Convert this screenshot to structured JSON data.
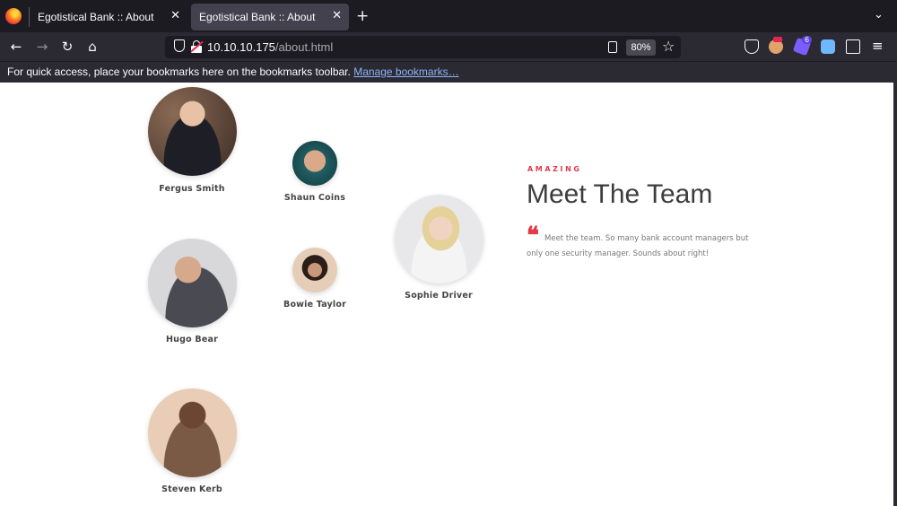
{
  "browser": {
    "tabs": [
      {
        "title": "Egotistical Bank :: About",
        "active": false
      },
      {
        "title": "Egotistical Bank :: About",
        "active": true
      }
    ],
    "url_host": "10.10.10.175",
    "url_path": "/about.html",
    "zoom": "80%",
    "bookmarks_hint": "For quick access, place your bookmarks here on the bookmarks toolbar.",
    "bookmarks_link": "Manage bookmarks…",
    "extension_badge": "6",
    "icons": [
      "firefox-logo-icon",
      "close-icon",
      "plus-icon",
      "chevron-down-icon",
      "back-icon",
      "forward-icon",
      "reload-icon",
      "home-icon",
      "shield-icon",
      "lock-insecure-icon",
      "reader-view-icon",
      "star-icon",
      "pocket-icon",
      "extension-icon",
      "puzzle-icon",
      "hamburger-menu-icon"
    ]
  },
  "page": {
    "team": [
      {
        "name": "Fergus Smith"
      },
      {
        "name": "Shaun Coins"
      },
      {
        "name": "Sophie Driver"
      },
      {
        "name": "Hugo Bear"
      },
      {
        "name": "Bowie Taylor"
      },
      {
        "name": "Steven Kerb"
      }
    ],
    "eyebrow": "AMAZING",
    "title": "Meet The Team",
    "quote": "Meet the team. So many bank account managers but only one security manager. Sounds about right!",
    "accent_color": "#e4384a"
  }
}
